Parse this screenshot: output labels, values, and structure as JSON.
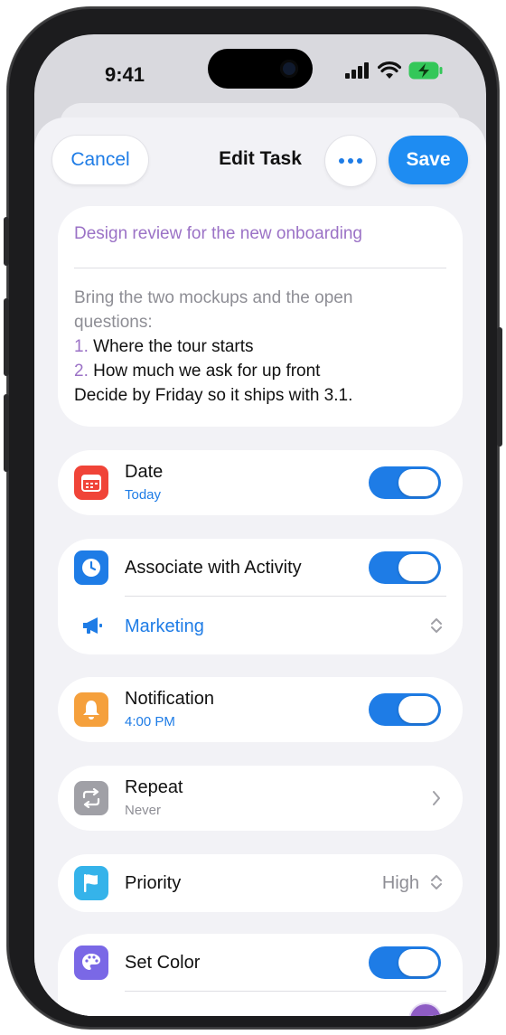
{
  "status_bar": {
    "time": "9:41"
  },
  "nav": {
    "cancel_label": "Cancel",
    "title": "Edit Task",
    "save_label": "Save"
  },
  "task": {
    "title": "Design review for the new onboarding",
    "notes_intro_1": "Bring the two mockups and the open",
    "notes_intro_2": "questions:",
    "list": [
      {
        "num": "1.",
        "text": "Where the tour starts"
      },
      {
        "num": "2.",
        "text": "How much we ask for up front"
      }
    ],
    "notes_outro": "Decide by Friday so it ships with 3.1."
  },
  "rows": {
    "date": {
      "label": "Date",
      "value": "Today",
      "enabled": true,
      "icon": "calendar-icon",
      "icon_color": "#f04438"
    },
    "activity": {
      "label": "Associate with Activity",
      "enabled": true,
      "icon": "clock-icon",
      "icon_color": "#1e7ce6",
      "selected": "Marketing",
      "selected_icon": "megaphone-icon"
    },
    "notification": {
      "label": "Notification",
      "value": "4:00 PM",
      "enabled": true,
      "icon": "bell-icon",
      "icon_color": "#f5a03c"
    },
    "repeat": {
      "label": "Repeat",
      "value": "Never",
      "icon": "repeat-icon",
      "icon_color": "#a0a0a6"
    },
    "priority": {
      "label": "Priority",
      "value": "High",
      "icon": "flag-icon",
      "icon_color": "#35b3ea"
    },
    "color": {
      "label": "Set Color",
      "enabled": true,
      "icon": "palette-icon",
      "icon_color": "#7a68e6",
      "swatch_color": "#8e5cc4"
    }
  },
  "colors": {
    "accent": "#1e7ce6",
    "save": "#1e8cf2",
    "title_purple": "#9b72c6"
  }
}
